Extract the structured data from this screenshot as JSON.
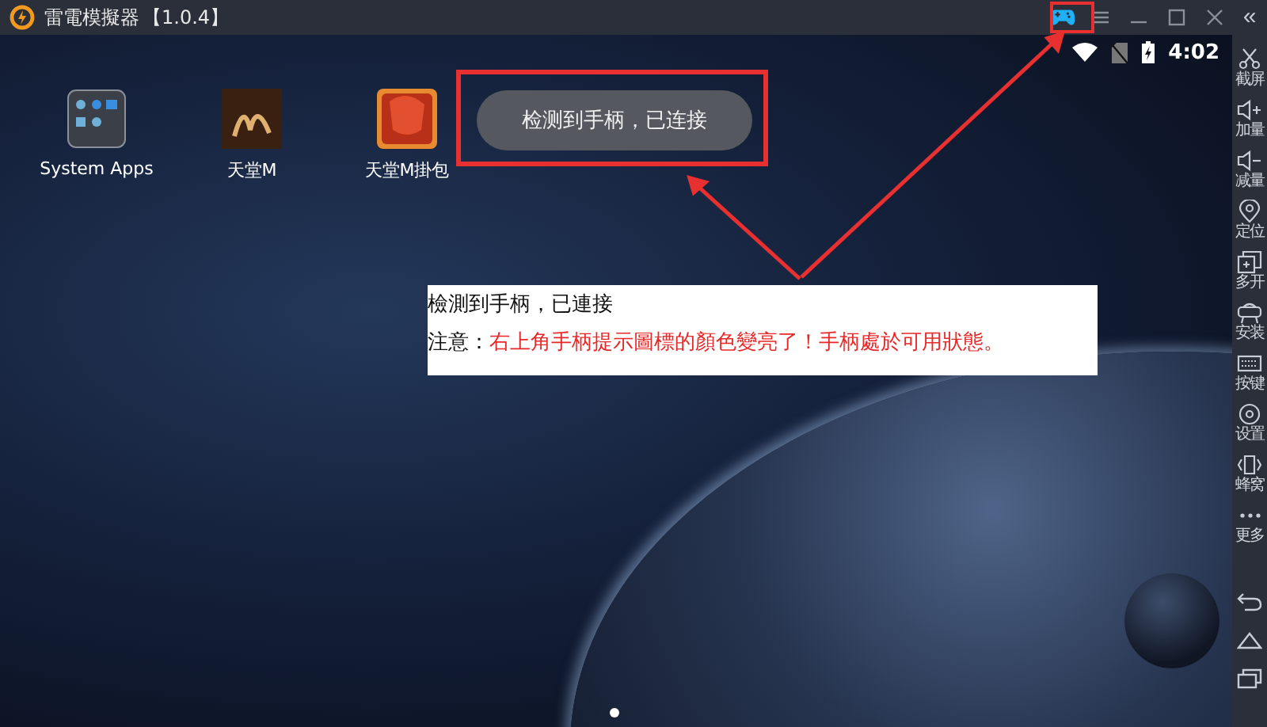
{
  "window": {
    "app_name": "雷電模擬器",
    "version": "【1.0.4】",
    "gamepad_connected": true,
    "collapse": "«"
  },
  "status_bar": {
    "time": "4:02"
  },
  "desktop": {
    "apps": [
      {
        "label": "System Apps"
      },
      {
        "label": "天堂M"
      },
      {
        "label": "天堂M掛包"
      }
    ]
  },
  "toast": {
    "text": "检测到手柄，已连接"
  },
  "annotation": {
    "title": "檢測到手柄，已連接",
    "prefix": "注意：",
    "message": "右上角手柄提示圖標的顏色變亮了！手柄處於可用狀態。"
  },
  "sidebar": {
    "items": [
      {
        "label": "截屏"
      },
      {
        "label": "加量"
      },
      {
        "label": "减量"
      },
      {
        "label": "定位"
      },
      {
        "label": "多开"
      },
      {
        "label": "安装"
      },
      {
        "label": "按键"
      },
      {
        "label": "设置"
      },
      {
        "label": "蜂窝"
      },
      {
        "label": "更多"
      }
    ]
  }
}
